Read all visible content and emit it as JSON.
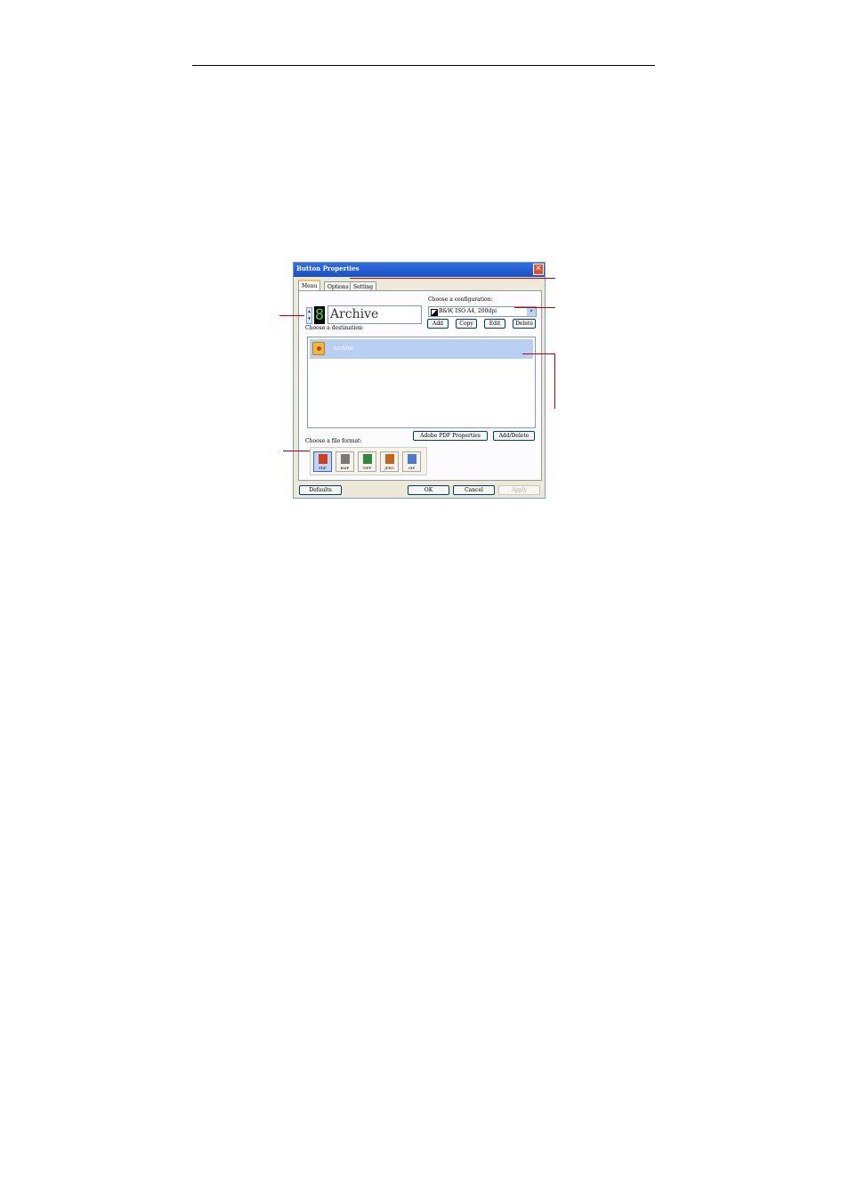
{
  "dialog": {
    "title": "Button Properties",
    "close_glyph": "✕",
    "tabs": [
      {
        "label": "Menu",
        "active": true
      },
      {
        "label": "Options",
        "active": false
      },
      {
        "label": "Setting",
        "active": false
      }
    ],
    "button_number": "8",
    "spinner_up": "▴",
    "spinner_down": "▾",
    "button_name": "Archive",
    "configuration": {
      "label": "Choose a configuration:",
      "selected": "B&W, ISO A4, 200dpi",
      "icon": "bw-config-icon",
      "arrow": "▾",
      "buttons": [
        "Add",
        "Copy",
        "Edit",
        "Delete"
      ]
    },
    "destination": {
      "label": "Choose a destination:",
      "items": [
        {
          "label": "Archive",
          "icon": "archive-folder-icon",
          "selected": true
        }
      ],
      "properties_button": "Adobe PDF Properties",
      "add_delete_button": "Add/Delete"
    },
    "file_format": {
      "label": "Choose a file format:",
      "formats": [
        {
          "label": "PDF",
          "color": "#d23b1c",
          "selected": true
        },
        {
          "label": "BMP",
          "color": "#7a7a7a",
          "selected": false
        },
        {
          "label": "TIFF",
          "color": "#2d8a3a",
          "selected": false
        },
        {
          "label": "JPEG",
          "color": "#c4641b",
          "selected": false
        },
        {
          "label": "GIF",
          "color": "#4a7ac8",
          "selected": false
        }
      ]
    },
    "footer": {
      "defaults": "Defaults",
      "ok": "OK",
      "cancel": "Cancel",
      "apply": "Apply"
    }
  },
  "colors": {
    "callout": "#c00000",
    "titlebar": "#1a4fc4",
    "selection": "#b9cff3"
  }
}
